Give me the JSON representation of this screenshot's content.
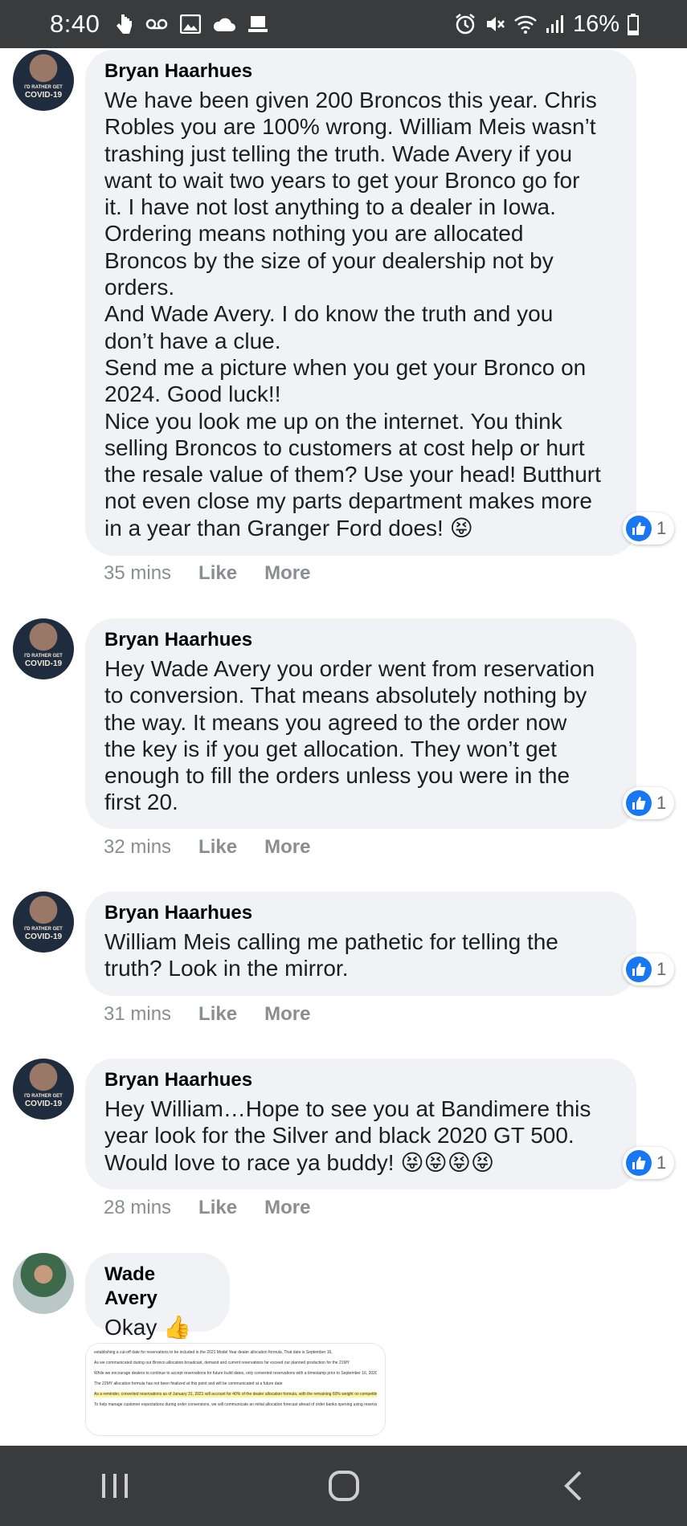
{
  "status_bar": {
    "time": "8:40",
    "battery": "16%",
    "left_icons": [
      "touch-icon",
      "voicemail-icon",
      "gallery-icon",
      "cloud-icon",
      "laptop-icon"
    ],
    "right_icons": [
      "alarm-icon",
      "mute-icon",
      "wifi-icon",
      "signal-icon",
      "battery-icon"
    ]
  },
  "comments": [
    {
      "author": "Bryan Haarhues",
      "text": "We have been given 200 Broncos this year. Chris\nRobles you are 100% wrong. William Meis wasn’t\ntrashing just telling the truth. Wade Avery if you\nwant to wait two years to get your Bronco go for\nit. I have not lost anything to a dealer in Iowa.\nOrdering means nothing you are allocated\nBroncos by the size of your dealership not by\norders.\nAnd Wade Avery. I do know the truth and you\ndon’t have a clue.\nSend me a picture when you get your Bronco on\n2024. Good luck!!\nNice you look me up on the internet. You think\nselling Broncos to customers at cost help or hurt\nthe resale value of them? Use your head! Butthurt\nnot even close my parts department makes more\nin a year than Granger Ford does! 😝",
      "time": "35 mins",
      "like": "Like",
      "more": "More",
      "reactions": "1"
    },
    {
      "author": "Bryan Haarhues",
      "text": "Hey Wade Avery you order went from reservation\nto conversion. That means absolutely nothing by\nthe way. It means you agreed to the order now\nthe key is if you get allocation. They won’t get\nenough to fill the orders unless you were in the\nfirst 20.",
      "time": "32 mins",
      "like": "Like",
      "more": "More",
      "reactions": "1"
    },
    {
      "author": "Bryan Haarhues",
      "text": "William Meis calling me pathetic for telling the\ntruth? Look in the mirror.",
      "time": "31 mins",
      "like": "Like",
      "more": "More",
      "reactions": "1"
    },
    {
      "author": "Bryan Haarhues",
      "text": "Hey William…Hope to see you at Bandimere this\nyear look for the Silver and black 2020 GT 500.\nWould love to race ya buddy! 😝😝😝😝",
      "time": "28 mins",
      "like": "Like",
      "more": "More",
      "reactions": "1"
    },
    {
      "author": "Wade Avery",
      "text": "Okay 👍"
    }
  ],
  "attachment": {
    "lines": [
      "establishing a cut-off date for reservations to be included in the 2021 Model Year dealer allocation formula. That date is September 16,",
      "As we communicated during our Bronco allocation broadcast, demand and current reservations far exceed our planned production for the 21MY",
      "While we encourage dealers to continue to accept reservations for future build dates, only converted reservations with a timestamp prior to September 16, 2020 will be included in your 21 MY dealer allocation formula",
      "The 22MY allocation formula has not been finalized at this point and will be communicated at a future date",
      "As a reminder, converted reservations as of January 31, 2021 will account for 40% of the dealer allocation formula, with the remaining 60% weight on competitive registrations and your Ford retail sales as a percentage of the nation",
      "To help manage customer expectations during order conversions, we will communicate an initial allocation forecast ahead of order banks opening using reservations as of September 16th (prior to conversion) along with the other allocation formula factors"
    ]
  },
  "nav_bar": {
    "buttons": [
      "recent-apps-icon",
      "home-icon",
      "back-icon"
    ]
  }
}
